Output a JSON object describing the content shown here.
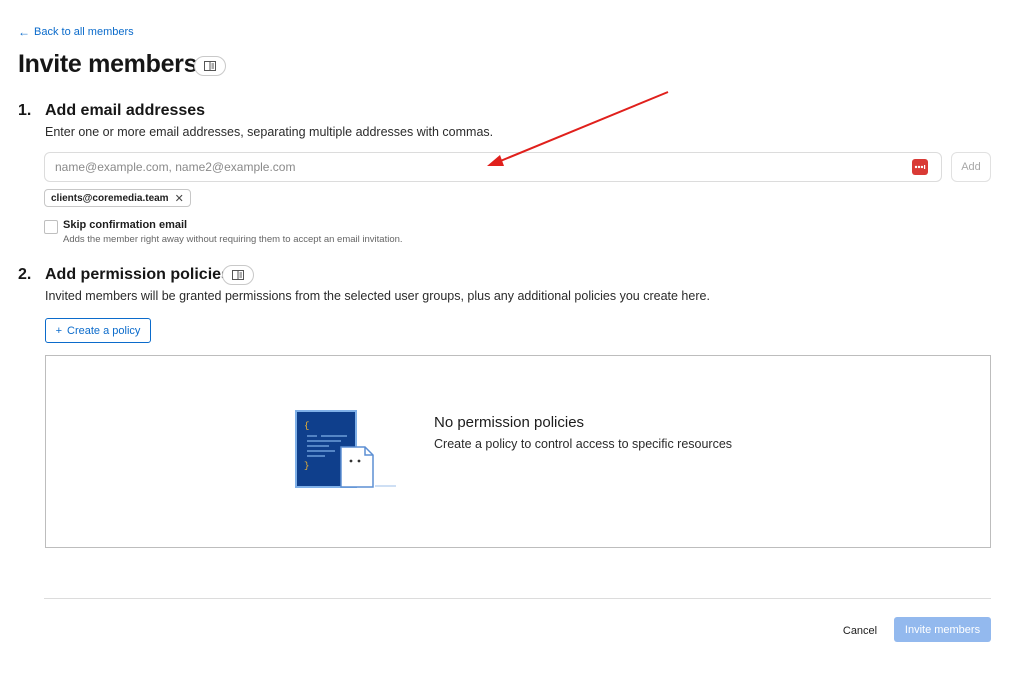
{
  "nav": {
    "back_label": "Back to all members"
  },
  "page": {
    "title": "Invite members"
  },
  "step1": {
    "number": "1.",
    "heading": "Add email addresses",
    "description": "Enter one or more email addresses, separating multiple addresses with commas.",
    "email_input": {
      "placeholder": "name@example.com, name2@example.com",
      "value": ""
    },
    "add_label": "Add",
    "emails": [
      "clients@coremedia.team"
    ],
    "skip_confirmation": {
      "label": "Skip confirmation email",
      "help": "Adds the member right away without requiring them to accept an email invitation.",
      "checked": false
    }
  },
  "step2": {
    "number": "2.",
    "heading": "Add permission policies",
    "description": "Invited members will be granted permissions from the selected user groups, plus any additional policies you create here.",
    "create_label": "Create a policy",
    "empty_title": "No permission policies",
    "empty_description": "Create a policy to control access to specific resources"
  },
  "footer": {
    "cancel_label": "Cancel",
    "invite_label": "Invite members"
  },
  "icons": {
    "back": "arrow-left-icon",
    "docs": "sidebar-panel-icon",
    "remove": "close-icon",
    "add": "plus-icon",
    "password_manager": "password-manager-icon"
  },
  "colors": {
    "link": "#0b6bcb",
    "primary_disabled": "#93b9ee",
    "annotation": "#e0201c",
    "password_badge": "#d93a35",
    "illustration": "#0f3f8c"
  }
}
